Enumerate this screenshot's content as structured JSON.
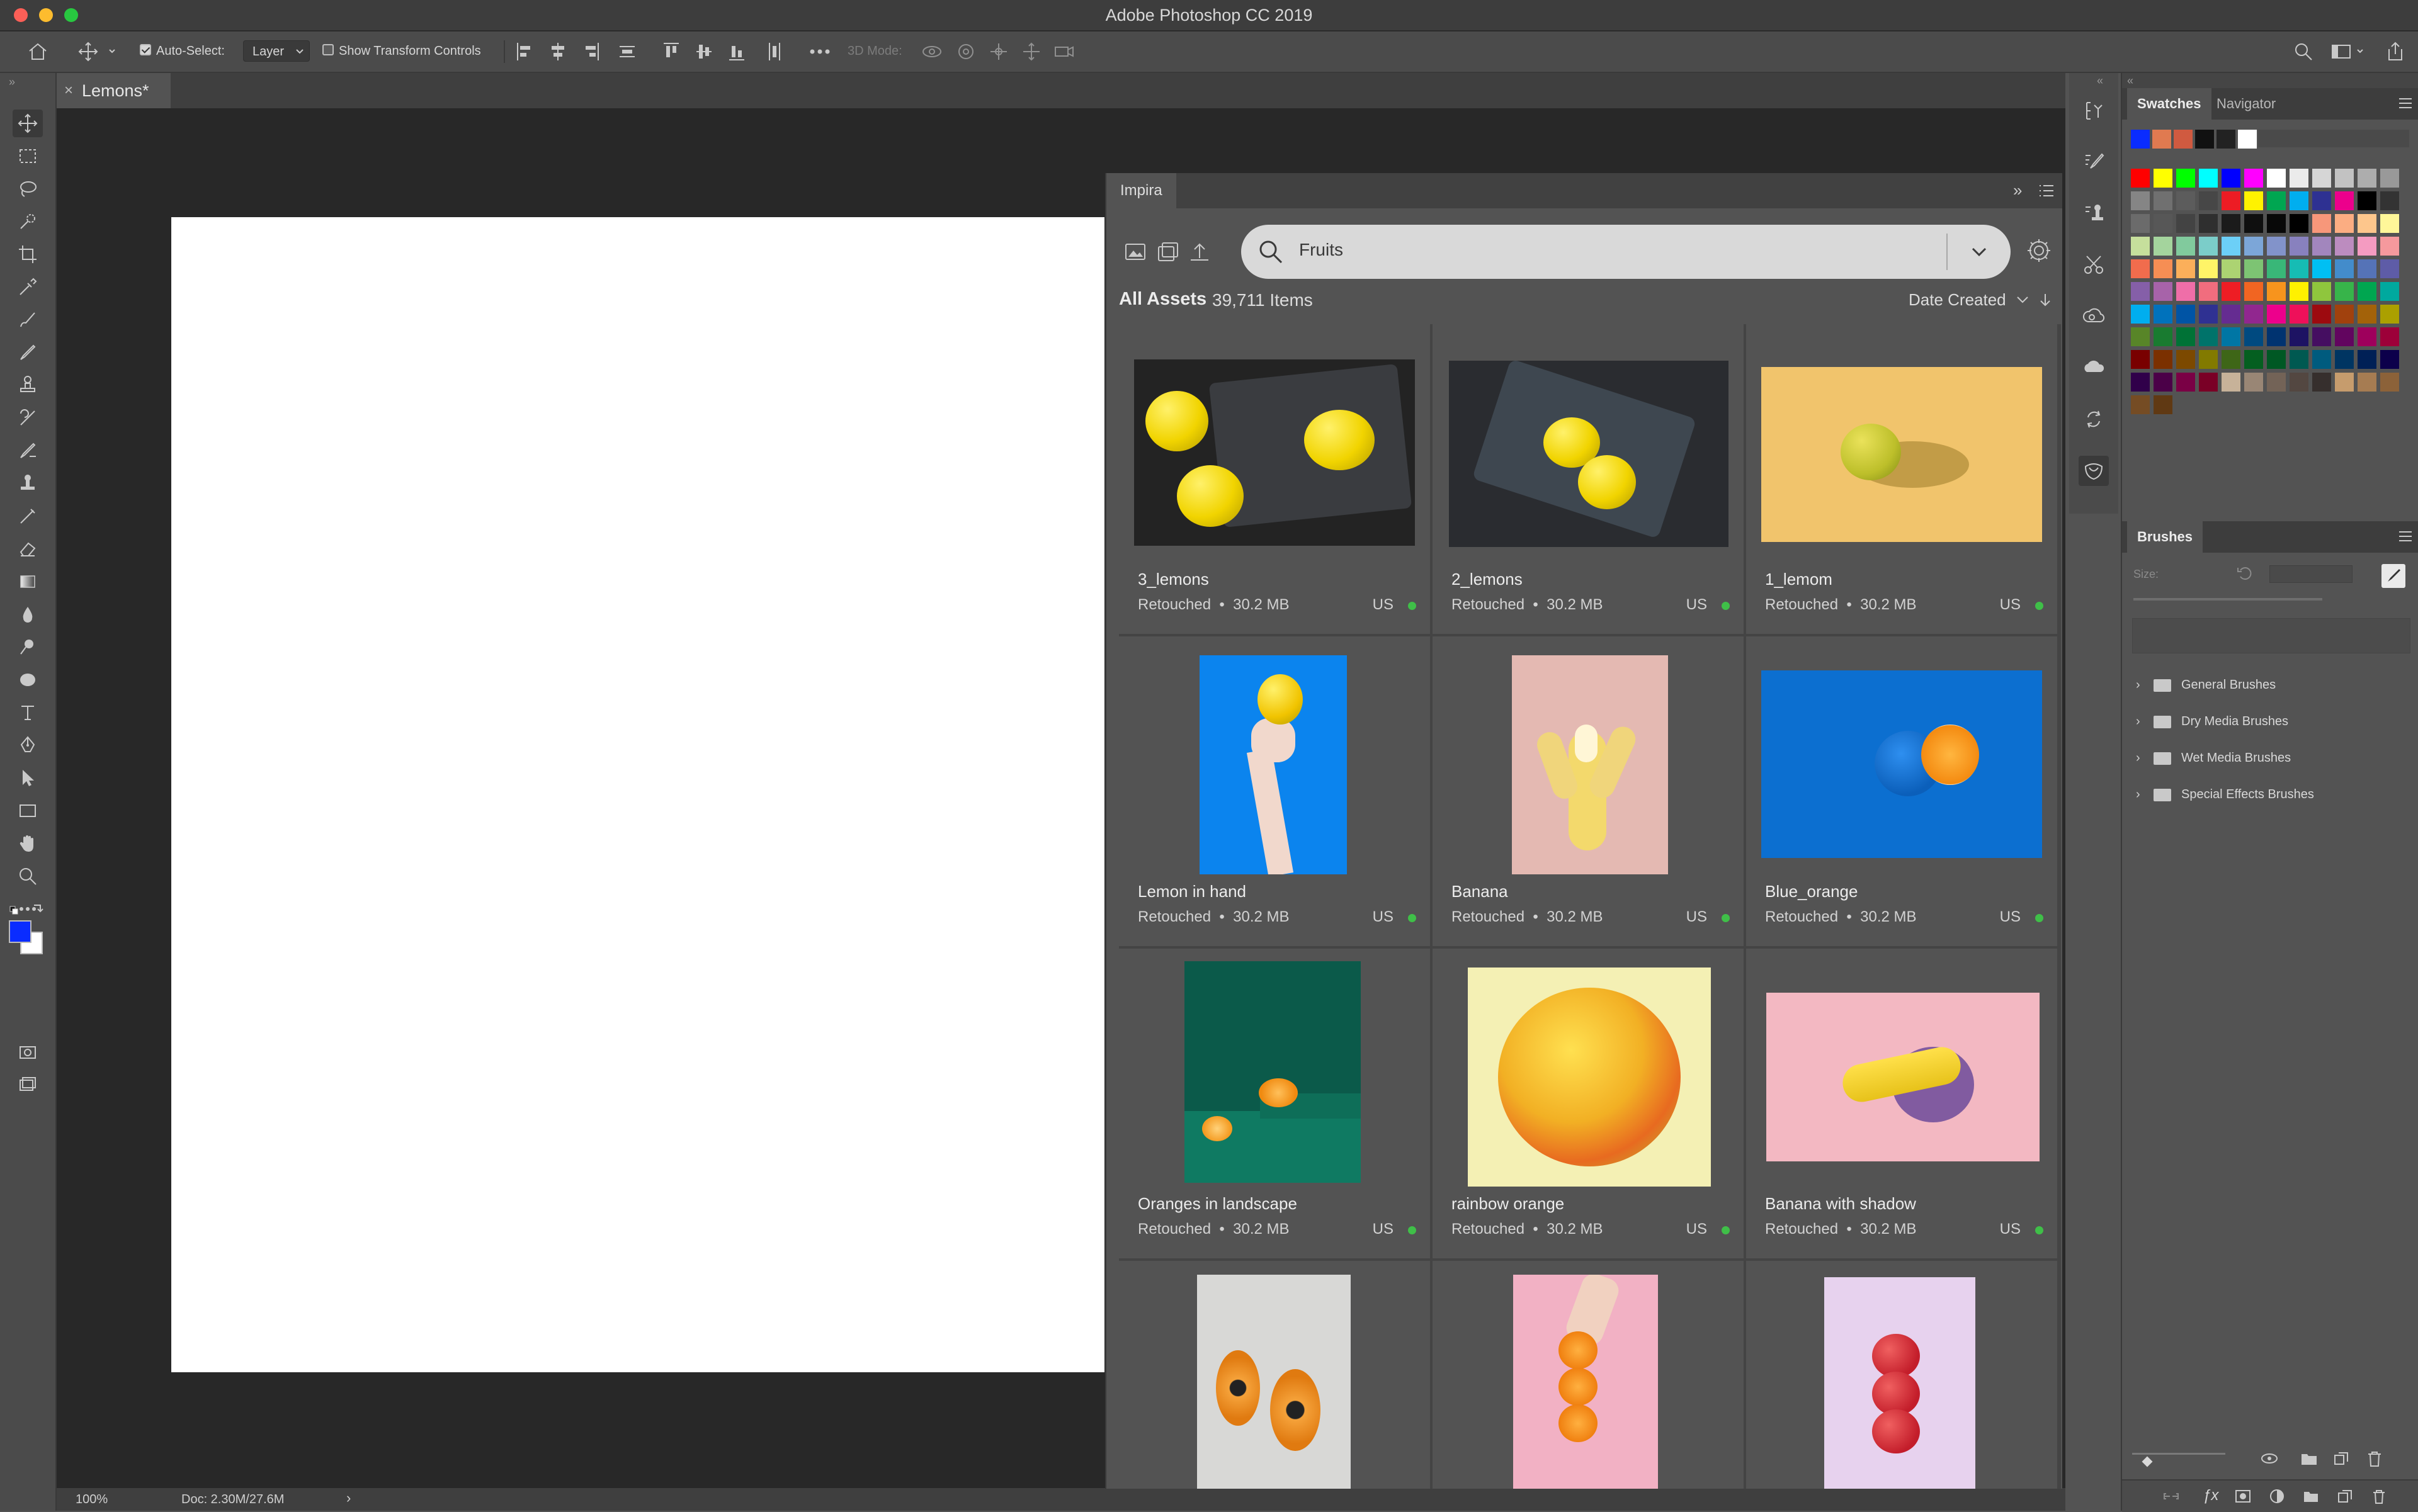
{
  "app": {
    "title": "Adobe Photoshop CC 2019"
  },
  "options_bar": {
    "auto_select_label": "Auto-Select:",
    "layer_value": "Layer",
    "show_transform_label": "Show Transform Controls",
    "mode_3d_label": "3D Mode:"
  },
  "document": {
    "tab_title": "Lemons*",
    "close_glyph": "×",
    "zoom": "100%",
    "doc_info": "Doc: 2.30M/27.6M"
  },
  "colors": {
    "foreground": "#0a2cff",
    "background": "#ffffff"
  },
  "impira": {
    "tab_label": "Impira",
    "search_value": "Fruits",
    "section_title": "All Assets",
    "item_count": "39,711 Items",
    "sort_label": "Date Created",
    "assets": [
      {
        "name": "3_lemons",
        "status": "Retouched",
        "size": "30.2 MB",
        "location": "US",
        "art": "lemons3"
      },
      {
        "name": "2_lemons",
        "status": "Retouched",
        "size": "30.2 MB",
        "location": "US",
        "art": "lemons2"
      },
      {
        "name": "1_lemom",
        "status": "Retouched",
        "size": "30.2 MB",
        "location": "US",
        "art": "lemon1"
      },
      {
        "name": "Lemon in hand",
        "status": "Retouched",
        "size": "30.2 MB",
        "location": "US",
        "art": "lemonhand"
      },
      {
        "name": "Banana",
        "status": "Retouched",
        "size": "30.2 MB",
        "location": "US",
        "art": "banana"
      },
      {
        "name": "Blue_orange",
        "status": "Retouched",
        "size": "30.2 MB",
        "location": "US",
        "art": "blueorange"
      },
      {
        "name": "Oranges in landscape",
        "status": "Retouched",
        "size": "30.2 MB",
        "location": "US",
        "art": "orangesland"
      },
      {
        "name": "rainbow orange",
        "status": "Retouched",
        "size": "30.2 MB",
        "location": "US",
        "art": "rainbow"
      },
      {
        "name": "Banana with shadow",
        "status": "Retouched",
        "size": "30.2 MB",
        "location": "US",
        "art": "bananashadow"
      },
      {
        "name": "",
        "status": "",
        "size": "",
        "location": "",
        "art": "papaya"
      },
      {
        "name": "",
        "status": "",
        "size": "",
        "location": "",
        "art": "orangestack"
      },
      {
        "name": "",
        "status": "",
        "size": "",
        "location": "",
        "art": "apples"
      }
    ]
  },
  "swatches_panel": {
    "tabs": [
      "Swatches",
      "Navigator"
    ],
    "recent": [
      "#0a2cff",
      "#e07a50",
      "#d05a40",
      "#111111",
      "#222222",
      "#ffffff"
    ],
    "grid": [
      [
        "#ff0000",
        "#ffff00",
        "#00ff00",
        "#00ffff",
        "#0000ff",
        "#ff00ff",
        "#ffffff",
        "#ebebeb",
        "#d6d6d6",
        "#c2c2c2",
        "#adadad",
        "#999999"
      ],
      [
        "#858585",
        "#707070",
        "#5c5c5c",
        "#474747",
        "#ed1c24",
        "#fff200",
        "#00a651",
        "#00aeef",
        "#2e3192",
        "#ec008c",
        "#000000",
        "#333333"
      ],
      [
        "#6b6b6b",
        "#575757",
        "#434343",
        "#2f2f2f",
        "#1b1b1b",
        "#0f0f0f",
        "#080808",
        "#000000",
        "#f7977a",
        "#fbad82",
        "#fdc68c",
        "#fff799"
      ],
      [
        "#c6df9c",
        "#a4d49d",
        "#81ca9d",
        "#7bcdc9",
        "#6ccff7",
        "#7ca6d8",
        "#8293ca",
        "#8881be",
        "#a286bd",
        "#bc8cbf",
        "#f49bc1",
        "#f5999d"
      ],
      [
        "#f16c4d",
        "#f68e54",
        "#fbaf5a",
        "#fff467",
        "#acd372",
        "#7dc473",
        "#39b778",
        "#16bcb4",
        "#00bff3",
        "#438ccb",
        "#5573b7",
        "#5e5ca7"
      ],
      [
        "#855fa8",
        "#a763a9",
        "#ef6ea8",
        "#f16d7e",
        "#ee1d24",
        "#f16522",
        "#f7941d",
        "#fff100",
        "#8fc63d",
        "#37b44a",
        "#00a650",
        "#00a99e"
      ],
      [
        "#00aeef",
        "#0072bc",
        "#0054a5",
        "#2f3192",
        "#652c91",
        "#91278f",
        "#ed008c",
        "#ee105a",
        "#9d0a0f",
        "#a1410d",
        "#a36209",
        "#aba000"
      ],
      [
        "#588528",
        "#197b30",
        "#007236",
        "#00736a",
        "#0076a4",
        "#004a80",
        "#003370",
        "#1d1363",
        "#450e61",
        "#62055f",
        "#9e005c",
        "#9d0039"
      ],
      [
        "#790000",
        "#7b3000",
        "#7c4900",
        "#827a00",
        "#3e6617",
        "#045f20",
        "#005824",
        "#005951",
        "#005b7e",
        "#003562",
        "#002056",
        "#0c004b"
      ],
      [
        "#30004a",
        "#4b0048",
        "#7a0045",
        "#7a0026",
        "#c7b299",
        "#998675",
        "#736357",
        "#534741",
        "#362f2d",
        "#c69c6d",
        "#a67c52",
        "#8c6239"
      ],
      [
        "#754c24",
        "#603913"
      ]
    ]
  },
  "brushes_panel": {
    "title": "Brushes",
    "size_label": "Size:",
    "folders": [
      "General Brushes",
      "Dry Media Brushes",
      "Wet Media Brushes",
      "Special Effects Brushes"
    ]
  }
}
